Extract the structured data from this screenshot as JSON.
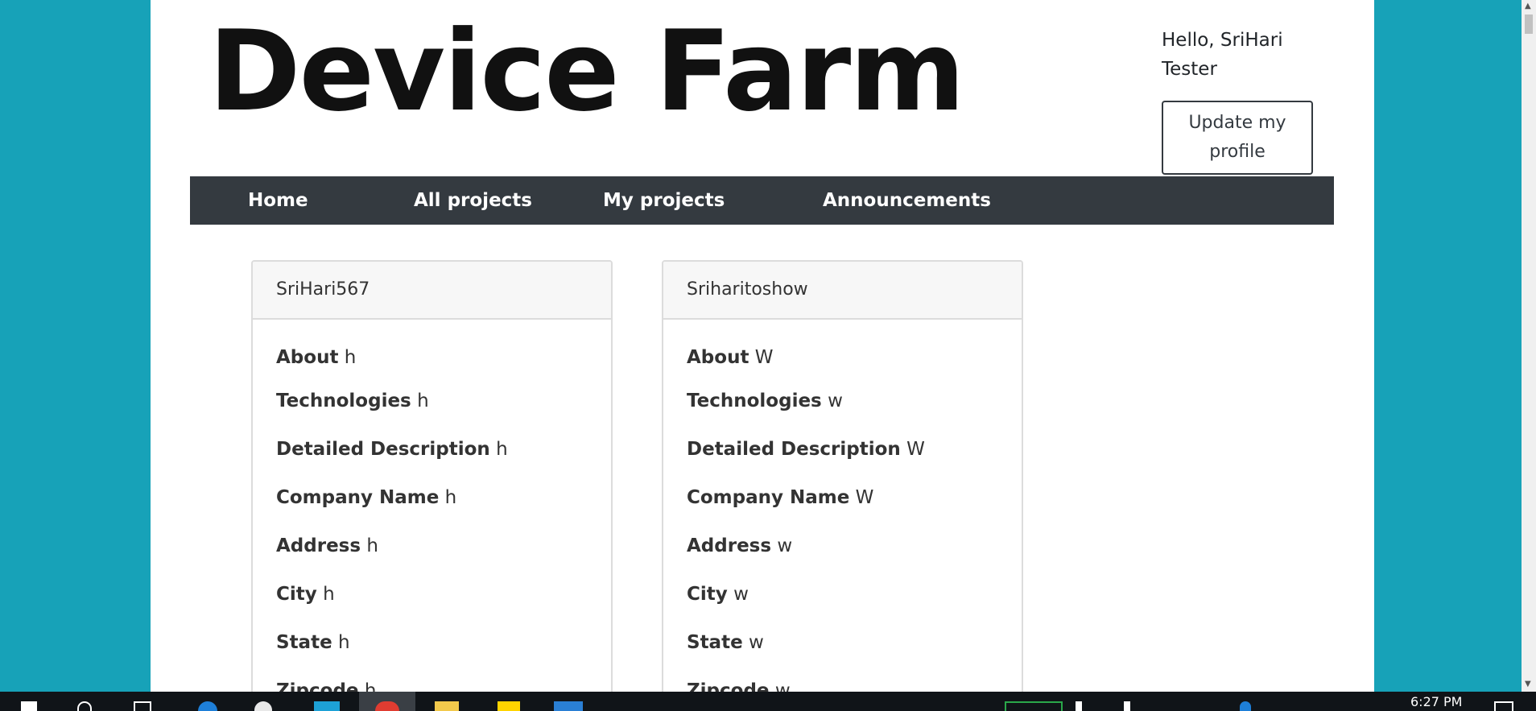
{
  "header": {
    "site_title": "Device Farm",
    "greeting": "Hello, SriHari Tester",
    "profile_button": "Update my profile"
  },
  "nav": {
    "items": [
      {
        "label": "Home"
      },
      {
        "label": "All projects"
      },
      {
        "label": "My projects"
      },
      {
        "label": "Announcements"
      }
    ]
  },
  "projects": [
    {
      "title": "SriHari567",
      "fields": [
        {
          "label": "About",
          "value": "h"
        },
        {
          "label": "Technologies",
          "value": "h"
        },
        {
          "label": "Detailed Description",
          "value": "h"
        },
        {
          "label": "Company Name",
          "value": "h"
        },
        {
          "label": "Address",
          "value": "h"
        },
        {
          "label": "City",
          "value": "h"
        },
        {
          "label": "State",
          "value": "h"
        },
        {
          "label": "Zipcode",
          "value": "h"
        }
      ]
    },
    {
      "title": "Sriharitoshow",
      "fields": [
        {
          "label": "About",
          "value": "W"
        },
        {
          "label": "Technologies",
          "value": "w"
        },
        {
          "label": "Detailed Description",
          "value": "W"
        },
        {
          "label": "Company Name",
          "value": "W"
        },
        {
          "label": "Address",
          "value": "w"
        },
        {
          "label": "City",
          "value": "w"
        },
        {
          "label": "State",
          "value": "w"
        },
        {
          "label": "Zipcode",
          "value": "w"
        }
      ]
    }
  ],
  "taskbar": {
    "time": "6:27 PM"
  },
  "colors": {
    "background": "#17a2b8",
    "navbar": "#343a40",
    "card_header": "#f7f7f7"
  }
}
